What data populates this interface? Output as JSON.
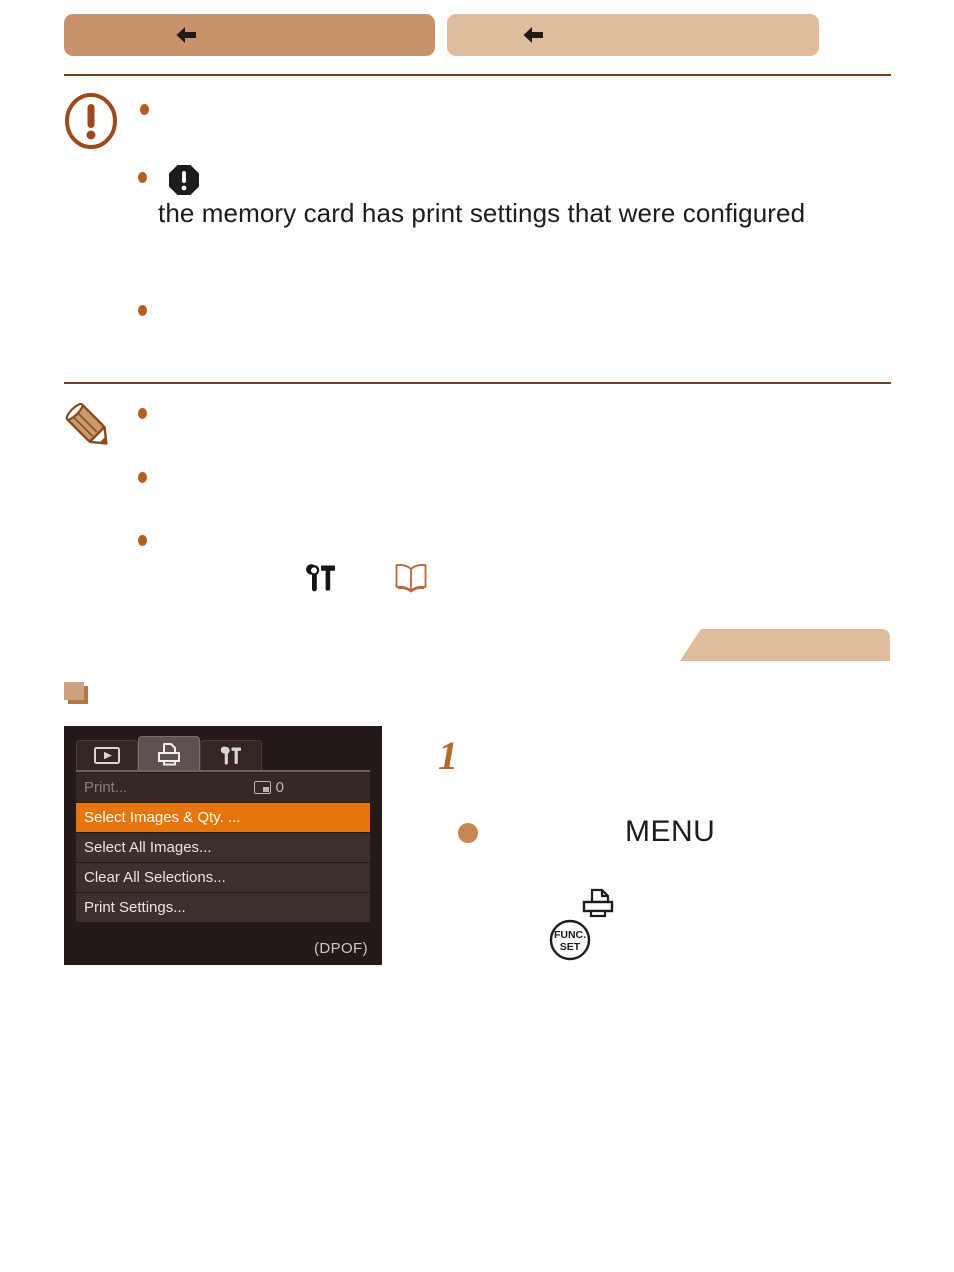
{
  "page": {
    "background_color": "#ffffff",
    "accent_color": "#b35f22",
    "rule_color": "#7b3f18"
  },
  "nav": {
    "pills": [
      {
        "id": "nav-pill-primary",
        "icon": "left-arrow-icon",
        "color": "#c8926a",
        "label": ""
      },
      {
        "id": "nav-pill-secondary",
        "icon": "left-arrow-icon",
        "color": "#e0bb9c",
        "label": ""
      }
    ]
  },
  "caution_block": {
    "icon": "caution-exclamation-circle-icon",
    "bullets": [
      {
        "text": ""
      },
      {
        "text": "",
        "inline_icon": "black-octagon-warning-icon",
        "continuation": "the memory card has print settings that were configured"
      },
      {
        "text": ""
      }
    ]
  },
  "note_block": {
    "icon": "note-pencil-icon",
    "bullets": [
      {
        "text": ""
      },
      {
        "text": ""
      },
      {
        "text": "",
        "inline_icons": [
          "tools-wrench-hammer-icon",
          "open-book-icon"
        ]
      }
    ]
  },
  "section": {
    "banner_color": "#e0bb9c",
    "marker_icon": "square-marker-icon",
    "heading": ""
  },
  "camera_menu": {
    "background_color": "#241a18",
    "tabs": [
      {
        "id": "tab-playback",
        "icon": "playback-triangle-icon",
        "active": false
      },
      {
        "id": "tab-print",
        "icon": "printer-icon",
        "active": true
      },
      {
        "id": "tab-settings",
        "icon": "wrench-hammer-icon",
        "active": false
      }
    ],
    "rows": [
      {
        "label": "Print...",
        "state": "disabled",
        "count_icon": "image-count-icon",
        "count": "0"
      },
      {
        "label": "Select Images & Qty. ...",
        "state": "highlight"
      },
      {
        "label": "Select All Images...",
        "state": "normal"
      },
      {
        "label": "Clear All Selections...",
        "state": "normal"
      },
      {
        "label": "Print Settings...",
        "state": "normal"
      }
    ],
    "footer_label": "(DPOF)",
    "highlight_color": "#e8740c"
  },
  "step": {
    "number": "1",
    "bullet_color": "#c8884f",
    "menu_button_label": "MENU",
    "icons": [
      "printer-icon",
      "func-set-button-icon"
    ],
    "func_set_top_label": "FUNC.",
    "func_set_bottom_label": "SET"
  }
}
